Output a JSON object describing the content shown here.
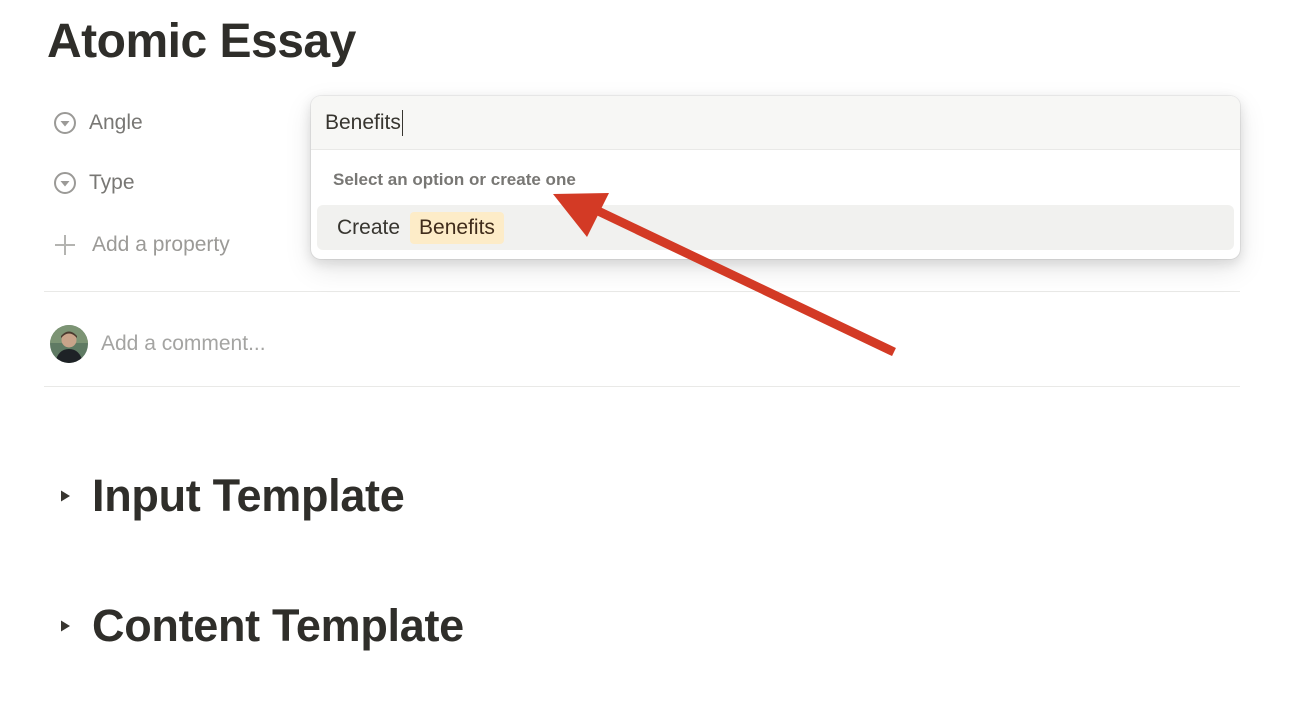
{
  "page": {
    "title": "Atomic Essay"
  },
  "properties": [
    {
      "label": "Angle",
      "icon": "select-circle-icon"
    },
    {
      "label": "Type",
      "icon": "select-circle-icon"
    }
  ],
  "add_property": {
    "label": "Add a property",
    "icon": "plus-icon"
  },
  "comments": {
    "placeholder": "Add a comment..."
  },
  "toggles": [
    {
      "title": "Input Template"
    },
    {
      "title": "Content Template"
    }
  ],
  "dropdown": {
    "search_value": "Benefits",
    "hint": "Select an option or create one",
    "create_label": "Create",
    "create_tag": "Benefits",
    "tag_color": "#fdecc8"
  },
  "annotation": {
    "arrow_color": "#d33a25"
  }
}
